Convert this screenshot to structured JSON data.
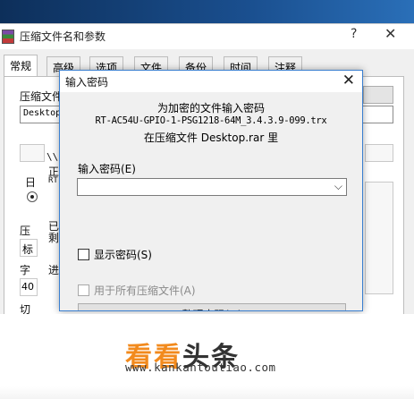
{
  "background_window": {
    "title": "压缩文件名和参数",
    "help_glyph": "?",
    "close_glyph": "✕",
    "tabs": [
      "常规",
      "高级",
      "选项",
      "文件",
      "备份",
      "时间",
      "注释"
    ],
    "active_tab": "常规",
    "archive_name_label": "压缩文件",
    "archive_name_value": "Desktop",
    "path_value": "\\\\",
    "status_text_1": "正",
    "status_text_2": "RT",
    "elapsed_label": "已",
    "remaining_label": "剩",
    "progress_label": "进",
    "compress_label": "压",
    "format_label": "压",
    "mode_label": "标",
    "dict_label": "字",
    "dict_value": "40",
    "split_label": "切",
    "radio_label": "日"
  },
  "dialog": {
    "title": "输入密码",
    "close_glyph": "✕",
    "message_line1": "为加密的文件输入密码",
    "message_line2": "RT-AC54U-GPIO-1-PSG1218-64M_3.4.3.9-099.trx",
    "message_line3": "在压缩文件 Desktop.rar 里",
    "password_label": "输入密码(E)",
    "password_value": "",
    "dropdown_glyph": "⌵",
    "show_password_label": "显示密码(S)",
    "use_for_all_label": "用于所有压缩文件(A)",
    "manage_button_label": "整理密码(O)"
  },
  "watermark": {
    "part1": "看看",
    "part2": "头条",
    "url": "www.kankantoutiao.com"
  },
  "colors": {
    "dialog_border": "#3a7fd0",
    "watermark_orange": "#f28a1d",
    "watermark_dark": "#333333"
  }
}
